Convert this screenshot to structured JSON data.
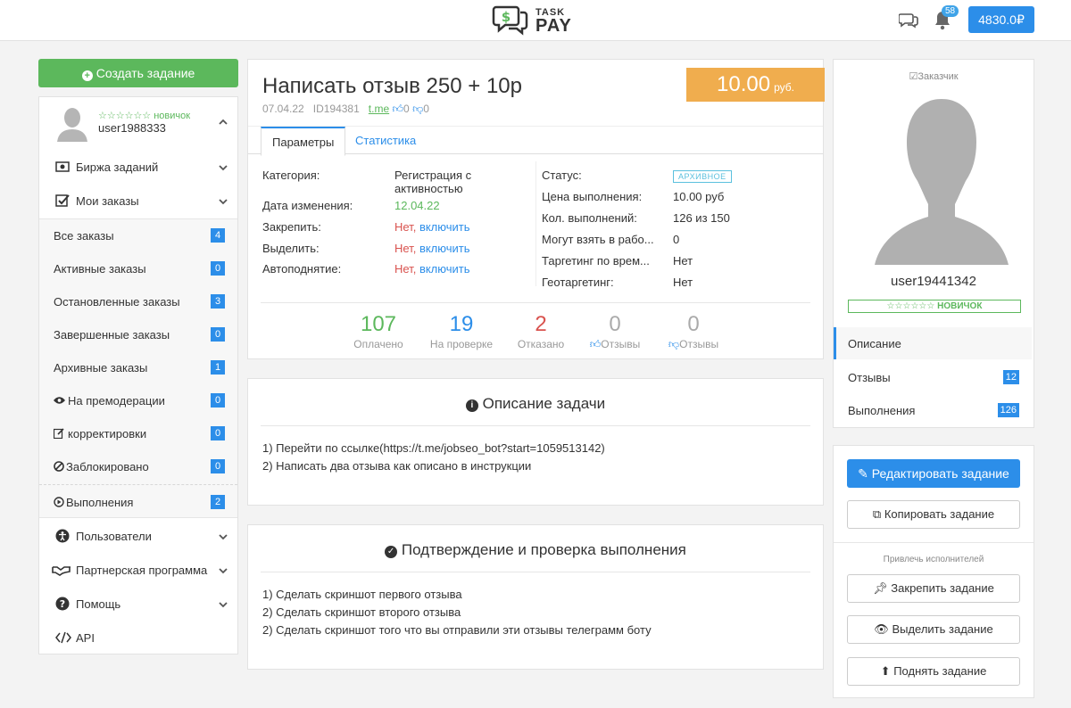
{
  "header": {
    "logo_top": "TASK",
    "logo_bottom": "PAY",
    "notifications_count": "58",
    "balance": "4830.0₽"
  },
  "sidebar": {
    "create_button": "Создать задание",
    "user": {
      "rank": "☆☆☆☆☆☆ новичок",
      "name": "user1988333"
    },
    "sections": [
      {
        "label": "Биржа заданий",
        "icon": "exchange-icon"
      },
      {
        "label": "Мои заказы",
        "icon": "checklist-icon"
      }
    ],
    "orders": [
      {
        "label": "Все заказы",
        "count": "4"
      },
      {
        "label": "Активные заказы",
        "count": "0"
      },
      {
        "label": "Остановленные заказы",
        "count": "3"
      },
      {
        "label": "Завершенные заказы",
        "count": "0"
      },
      {
        "label": "Архивные заказы",
        "count": "1"
      },
      {
        "label": "На премодерации",
        "count": "0",
        "icon": "eye-icon"
      },
      {
        "label": "корректировки",
        "count": "0",
        "icon": "edit-icon"
      },
      {
        "label": "Заблокировано",
        "count": "0",
        "icon": "ban-icon"
      },
      {
        "label": "Выполнения",
        "count": "2",
        "icon": "play-icon"
      }
    ],
    "bottom": [
      {
        "label": "Пользователи",
        "icon": "accessibility-icon"
      },
      {
        "label": "Партнерская программа",
        "icon": "handshake-icon"
      },
      {
        "label": "Помощь",
        "icon": "help-icon"
      },
      {
        "label": "API",
        "icon": "code-icon"
      }
    ]
  },
  "task": {
    "title": "Написать отзыв 250 + 10р",
    "date": "07.04.22",
    "id": "ID194381",
    "link": "t.me",
    "likes": "0",
    "dislikes": "0",
    "price": "10.00",
    "price_unit": "руб.",
    "tabs": [
      "Параметры",
      "Статистика"
    ],
    "params_left": [
      {
        "label": "Категория:",
        "value": "Регистрация с активностью"
      },
      {
        "label": "Дата изменения:",
        "value": "12.04.22"
      },
      {
        "label": "Закрепить:",
        "value_no": "Нет,",
        "value_action": "включить"
      },
      {
        "label": "Выделить:",
        "value_no": "Нет,",
        "value_action": "включить"
      },
      {
        "label": "Автоподнятие:",
        "value_no": "Нет,",
        "value_action": "включить"
      }
    ],
    "params_right": [
      {
        "label": "Статус:",
        "value": "АРХИВНОЕ"
      },
      {
        "label": "Цена выполнения:",
        "value": "10.00 руб"
      },
      {
        "label": "Кол. выполнений:",
        "value": "126 из 150"
      },
      {
        "label": "Могут взять в рабо...",
        "value": "0"
      },
      {
        "label": "Таргетинг по врем...",
        "value": "Нет"
      },
      {
        "label": "Геотаргетинг:",
        "value": "Нет"
      }
    ],
    "stats": [
      {
        "value": "107",
        "label": "Оплачено",
        "color": "#5cb85c"
      },
      {
        "value": "19",
        "label": "На проверке",
        "color": "#2c8ee9"
      },
      {
        "value": "2",
        "label": "Отказано",
        "color": "#d9534f"
      },
      {
        "value": "0",
        "label": "Отзывы",
        "color": "#aaaaaa"
      },
      {
        "value": "0",
        "label": "Отзывы",
        "color": "#aaaaaa"
      }
    ]
  },
  "description": {
    "title": "Описание задачи",
    "lines": [
      "1) Перейти по ссылке(https://t.me/jobseo_bot?start=1059513142)",
      "2) Написать два отзыва как описано в инструкции"
    ]
  },
  "confirmation": {
    "title": "Подтверждение и проверка выполнения",
    "lines": [
      "1) Сделать скриншот первого отзыва",
      "2) Сделать скриншот второго отзыва",
      "2) Сделать скриншот того что вы отправили эти отзывы телеграмм боту"
    ]
  },
  "owner": {
    "label": "Заказчик",
    "name": "user19441342",
    "rank": "☆☆☆☆☆☆ НОВИЧОК",
    "tabs": [
      {
        "label": "Описание",
        "count": ""
      },
      {
        "label": "Отзывы",
        "count": "12"
      },
      {
        "label": "Выполнения",
        "count": "126"
      }
    ]
  },
  "actions": {
    "edit": "Редактировать задание",
    "copy": "Копировать задание",
    "attract_label": "Привлечь исполнителей",
    "pin": "Закрепить задание",
    "highlight": "Выделить задание",
    "raise": "Поднять задание"
  }
}
